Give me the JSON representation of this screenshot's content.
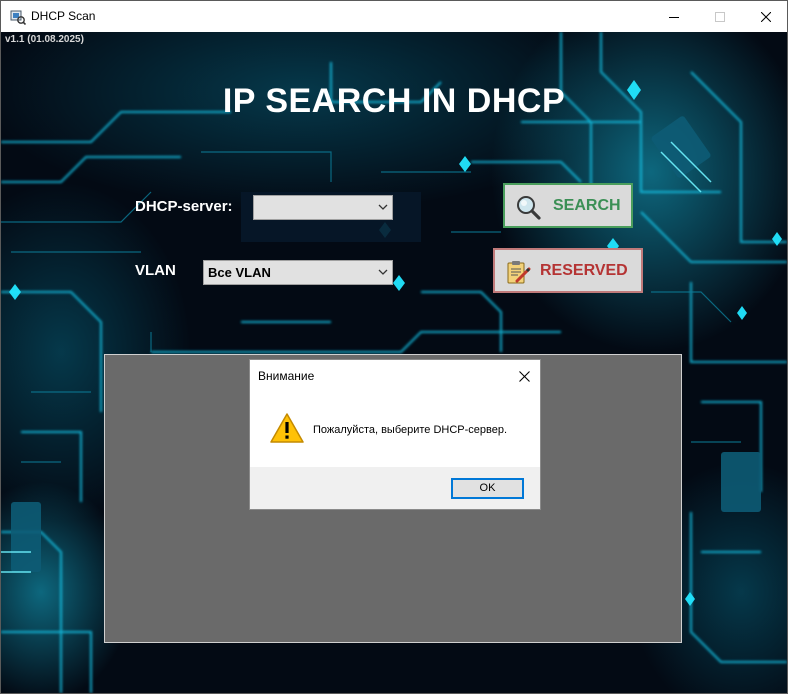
{
  "window": {
    "title": "DHCP Scan"
  },
  "app": {
    "version": "v1.1 (01.08.2025)",
    "title": "IP SEARCH IN DHCP"
  },
  "form": {
    "dhcp_label": "DHCP-server:",
    "dhcp_value": "",
    "vlan_label": "VLAN",
    "vlan_value": "Все VLAN"
  },
  "buttons": {
    "search_label": "SEARCH",
    "search_icon": "magnifier-icon",
    "reserved_label": "RESERVED",
    "reserved_icon": "clipboard-edit-icon"
  },
  "dialog": {
    "title": "Внимание",
    "message": "Пожалуйста, выберите DHCP-сервер.",
    "icon": "warning-icon",
    "ok_label": "OK"
  },
  "colors": {
    "search_text": "#3b8f55",
    "reserved_text": "#b53434",
    "accent_cyan": "#21e4ff",
    "panel_gray": "#6a6a6a"
  }
}
